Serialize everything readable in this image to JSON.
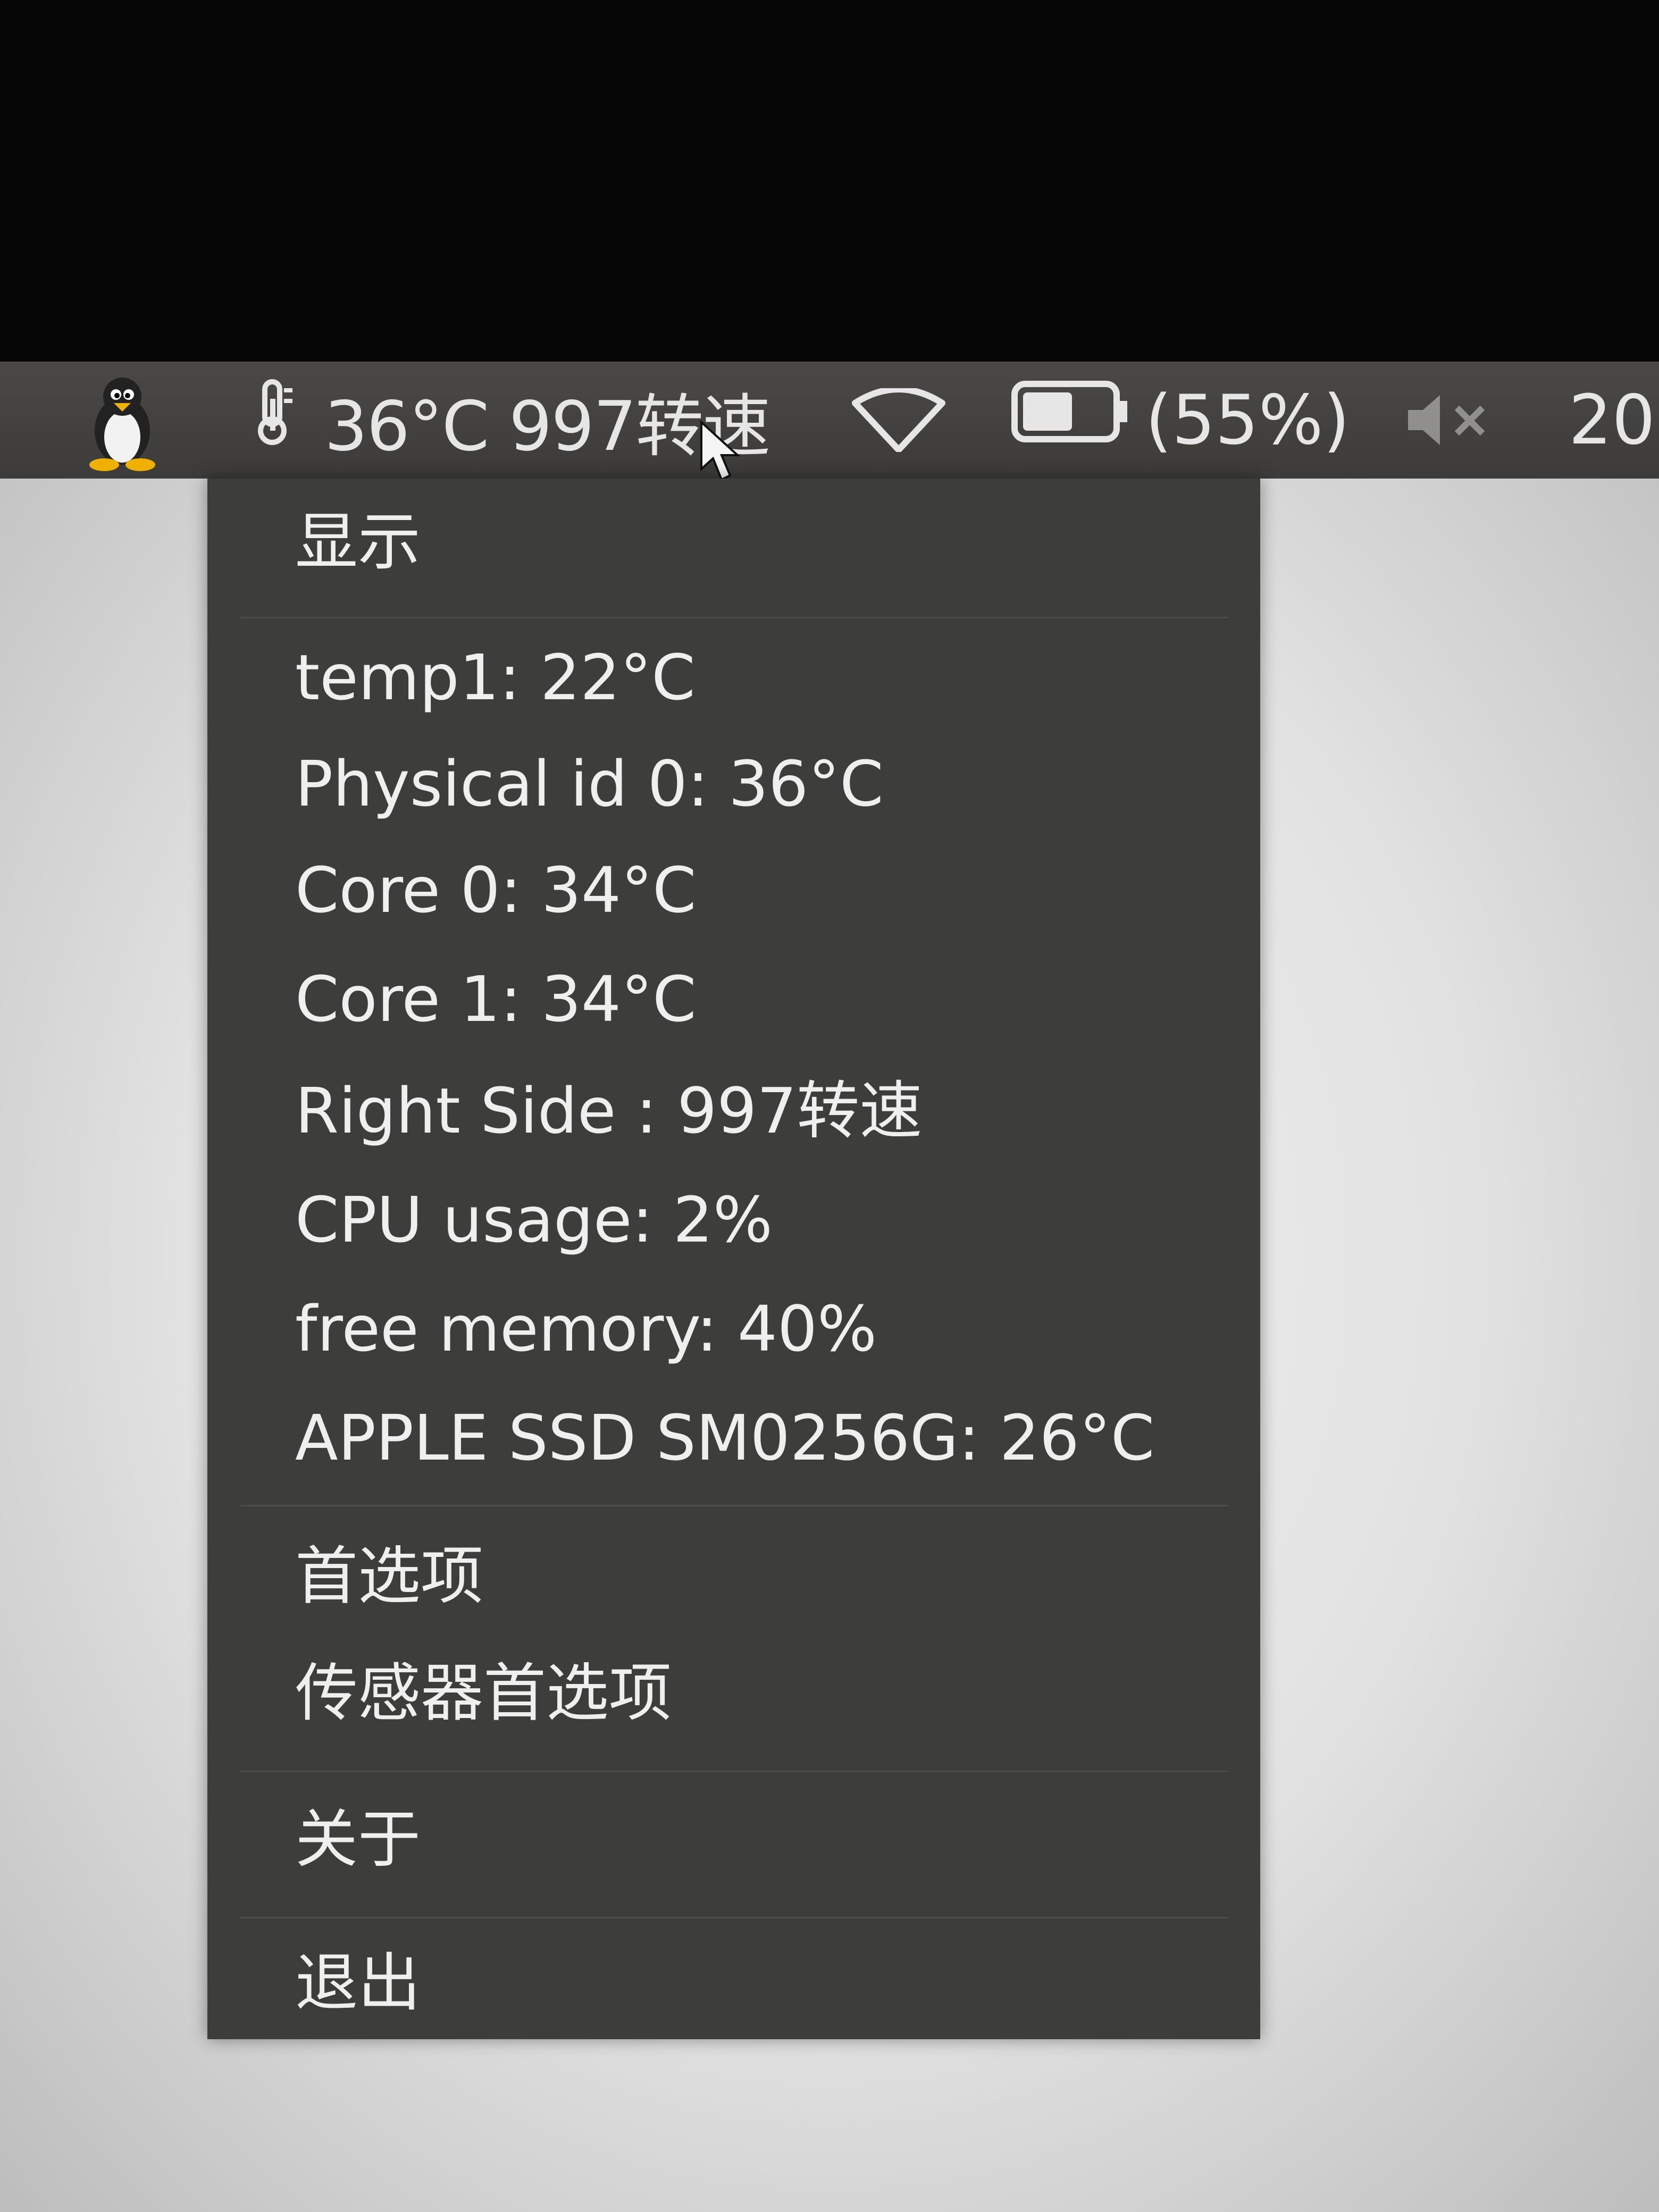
{
  "panel": {
    "temperature_readout": "36°C 997转速",
    "battery_percent": "(55%)",
    "clock_partial": "20",
    "volume_state": "muted",
    "icons": [
      "tux-logo-icon",
      "thermometer-icon",
      "wifi-icon",
      "battery-icon",
      "volume-muted-icon"
    ]
  },
  "menu": {
    "display_label": "显示",
    "sensors": [
      "temp1: 22°C",
      "Physical id 0: 36°C",
      "Core 0: 34°C",
      "Core 1: 34°C",
      "Right Side  : 997转速",
      "CPU usage: 2%",
      "free memory: 40%",
      "APPLE SSD SM0256G: 26°C"
    ],
    "preferences_label": "首选项",
    "sensor_preferences_label": "传感器首选项",
    "about_label": "关于",
    "quit_label": "退出"
  }
}
